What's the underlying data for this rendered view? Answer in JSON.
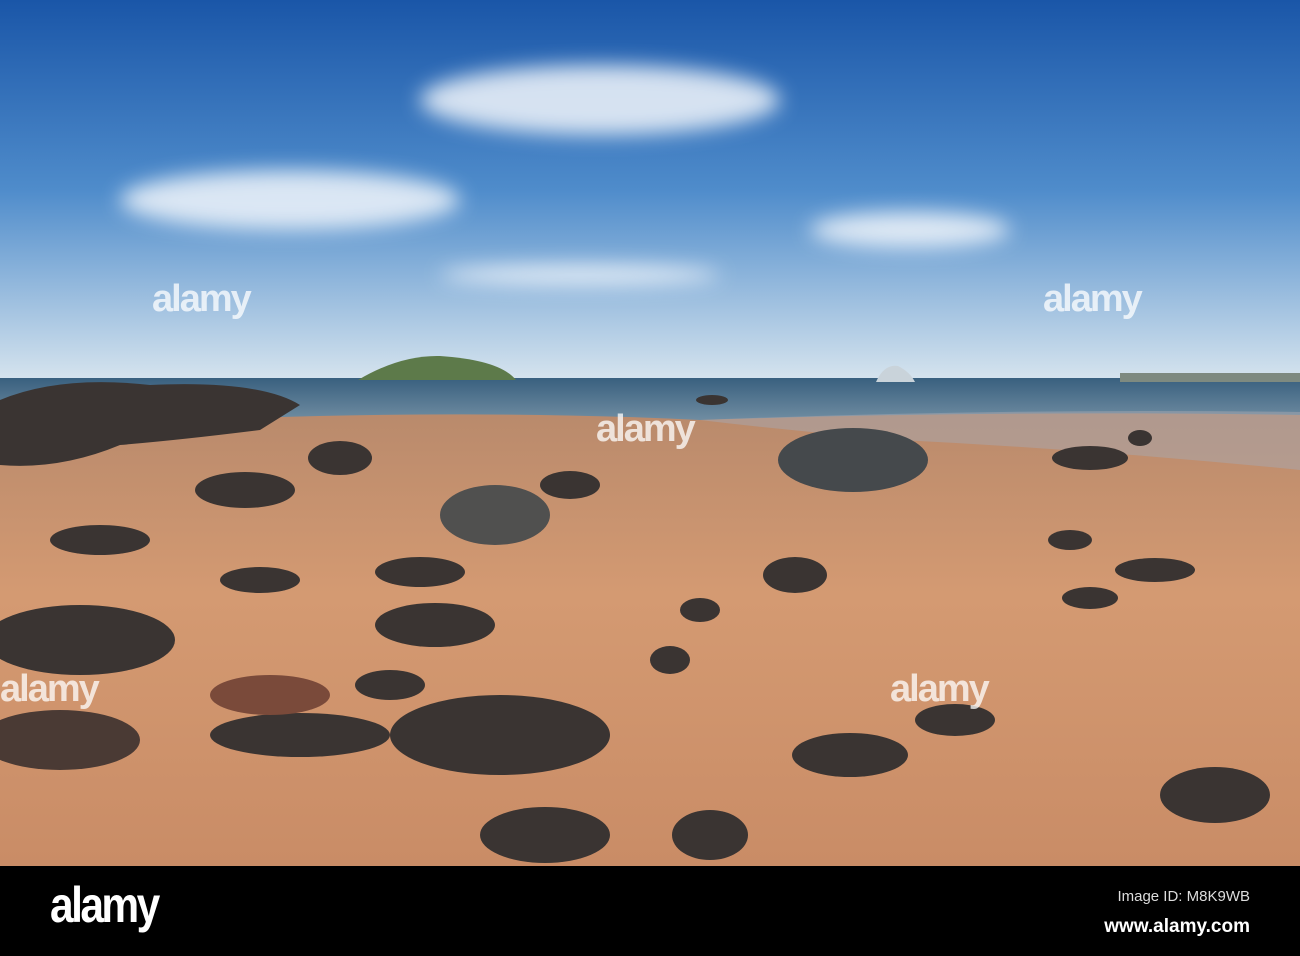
{
  "footer": {
    "logo": "alamy",
    "image_id": "Image ID: M8K9WB",
    "site": "www.alamy.com"
  },
  "watermark": "alamy"
}
